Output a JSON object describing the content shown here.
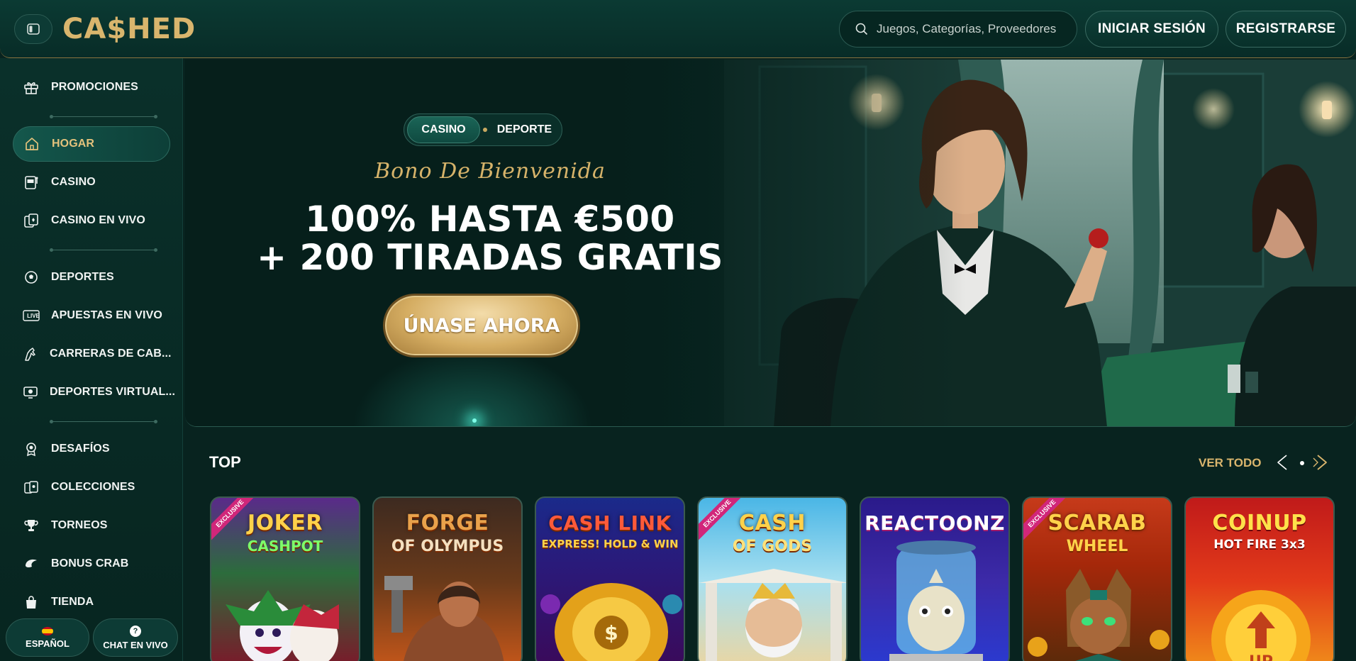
{
  "header": {
    "logo": "CA$HED",
    "search_placeholder": "Juegos, Categorías, Proveedores",
    "login_label": "INICIAR SESIÓN",
    "register_label": "REGISTRARSE"
  },
  "sidebar": {
    "items": [
      {
        "label": "PROMOCIONES",
        "icon": "gift-icon"
      },
      {
        "label": "HOGAR",
        "icon": "home-icon",
        "active": true
      },
      {
        "label": "CASINO",
        "icon": "slot-machine-icon"
      },
      {
        "label": "CASINO EN VIVO",
        "icon": "cards-icon"
      },
      {
        "label": "DEPORTES",
        "icon": "soccer-ball-icon"
      },
      {
        "label": "APUESTAS EN VIVO",
        "icon": "live-icon"
      },
      {
        "label": "CARRERAS DE CAB...",
        "icon": "horse-icon"
      },
      {
        "label": "DEPORTES VIRTUAL...",
        "icon": "monitor-ball-icon"
      },
      {
        "label": "DESAFÍOS",
        "icon": "medal-icon"
      },
      {
        "label": "COLECCIONES",
        "icon": "collection-cards-icon"
      },
      {
        "label": "TORNEOS",
        "icon": "trophy-icon"
      },
      {
        "label": "BONUS CRAB",
        "icon": "crab-icon"
      },
      {
        "label": "TIENDA",
        "icon": "shopping-bag-icon"
      }
    ],
    "language_label": "ESPAÑOL",
    "live_chat_label": "CHAT EN VIVO",
    "live_badge": "LIVE"
  },
  "hero": {
    "tab_casino": "CASINO",
    "tab_sport": "DEPORTE",
    "bonus_title": "Bono De Bienvenida",
    "offer_line1": "100% HASTA €500",
    "offer_line2": "+ 200 TIRADAS GRATIS",
    "cta_label": "ÚNASE AHORA"
  },
  "top": {
    "title": "TOP",
    "see_all": "VER TODO",
    "games": [
      {
        "name": "JOKER",
        "sub": "CASHPOT",
        "exclusive": true
      },
      {
        "name": "FORGE",
        "sub": "OF OLYMPUS",
        "exclusive": false
      },
      {
        "name": "CASH LINK",
        "sub": "EXPRESS! HOLD & WIN",
        "exclusive": false
      },
      {
        "name": "CASH",
        "sub": "OF GODS",
        "exclusive": true
      },
      {
        "name": "REACTOONZ",
        "sub": "",
        "exclusive": false
      },
      {
        "name": "SCARAB",
        "sub": "WHEEL",
        "exclusive": true
      },
      {
        "name": "COINUP",
        "sub": "HOT FIRE 3x3",
        "exclusive": false
      }
    ],
    "exclusive_label": "EXCLUSIVE"
  },
  "colors": {
    "accent_gold": "#d9b56d",
    "bg_dark_green": "#08231f"
  }
}
